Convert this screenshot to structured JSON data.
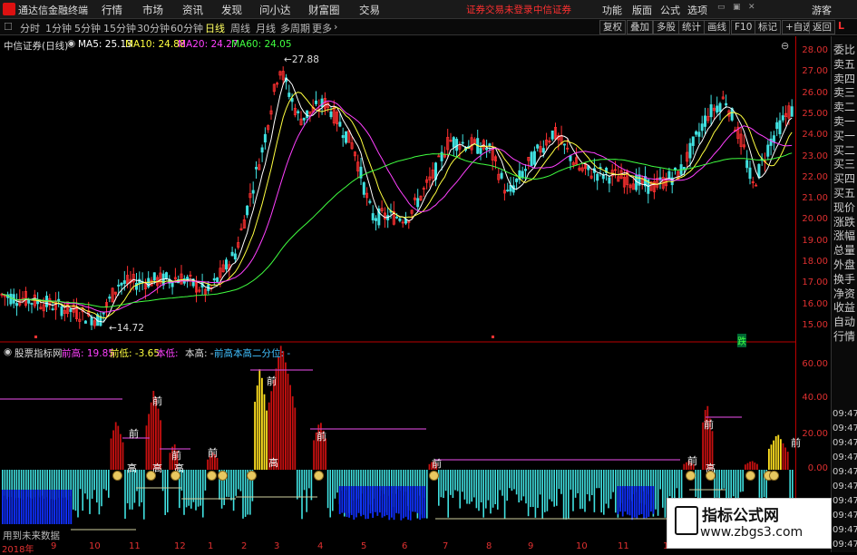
{
  "app": {
    "title": "通达信金融终端"
  },
  "menu": [
    "行情",
    "市场",
    "资讯",
    "发现",
    "问小达",
    "财富圈",
    "交易"
  ],
  "login_notice": "证券交易未登录",
  "broker": "中信证券",
  "right_menu": [
    "功能",
    "版面",
    "公式",
    "选项"
  ],
  "guest_label": "游客",
  "toolbar": {
    "periods": [
      "分时",
      "1分钟",
      "5分钟",
      "15分钟",
      "30分钟",
      "60分钟",
      "日线",
      "周线",
      "月线",
      "多周期",
      "更多"
    ],
    "active_period": "日线",
    "buttons": [
      "复权",
      "叠加",
      "多股",
      "统计",
      "画线",
      "F10",
      "标记",
      "+自选",
      "返回"
    ]
  },
  "main_chart": {
    "stock_label": "中信证券(日线)",
    "ma": [
      {
        "label": "MA5: 25.13",
        "color": "#ffffff"
      },
      {
        "label": "MA10: 24.88",
        "color": "#ffff40"
      },
      {
        "label": "MA20: 24.27",
        "color": "#ff40ff"
      },
      {
        "label": "MA60: 24.05",
        "color": "#40ff40"
      }
    ],
    "high_marker": "27.88",
    "low_marker": "14.72",
    "event_label": "跌"
  },
  "indicator": {
    "name": "股票指标网",
    "items": [
      {
        "label": "前高: 19.85",
        "color": "#ff40ff"
      },
      {
        "label": "前低: -3.65",
        "color": "#ffff40"
      },
      {
        "label": "本低: ",
        "color": "#ff40ff"
      },
      {
        "label": "本高: -",
        "color": "#dddddd"
      },
      {
        "label": "前高本高二分位: -",
        "color": "#40c0ff"
      }
    ],
    "future_note": "用到未来数据",
    "marks": {
      "qian": "前",
      "gao": "高"
    }
  },
  "y_axis_main": [
    "28.00",
    "27.00",
    "26.00",
    "25.00",
    "24.00",
    "23.00",
    "22.00",
    "21.00",
    "20.00",
    "19.00",
    "18.00",
    "17.00",
    "16.00",
    "15.00"
  ],
  "y_axis_indicator": [
    "60.00",
    "40.00",
    "20.00",
    "0.00"
  ],
  "x_axis": [
    "2018年",
    "9",
    "10",
    "11",
    "12",
    "1",
    "2",
    "3",
    "4",
    "5",
    "6",
    "7",
    "8",
    "9",
    "10",
    "11",
    "12"
  ],
  "right_panel": {
    "letter": "L",
    "items": [
      "委比",
      "卖五",
      "卖四",
      "卖三",
      "卖二",
      "卖一",
      "买一",
      "买二",
      "买三",
      "买四",
      "买五",
      "现价",
      "涨跌",
      "涨幅",
      "总量",
      "外盘",
      "换手",
      "净资",
      "收益",
      "自动",
      "行情"
    ],
    "times": [
      "09:47",
      "09:47",
      "09:47",
      "09:47",
      "09:47",
      "09:47",
      "09:47",
      "09:47",
      "09:47",
      "09:47"
    ]
  },
  "watermark": {
    "line1": "指标公式网",
    "line2": "www.zbgs3.com"
  },
  "colors": {
    "up": "#ff3030",
    "down": "#40e0e0",
    "ma5": "#ffffff",
    "ma10": "#ffff40",
    "ma20": "#ff40ff",
    "ma60": "#40ff40",
    "axis": "#e03030"
  }
}
